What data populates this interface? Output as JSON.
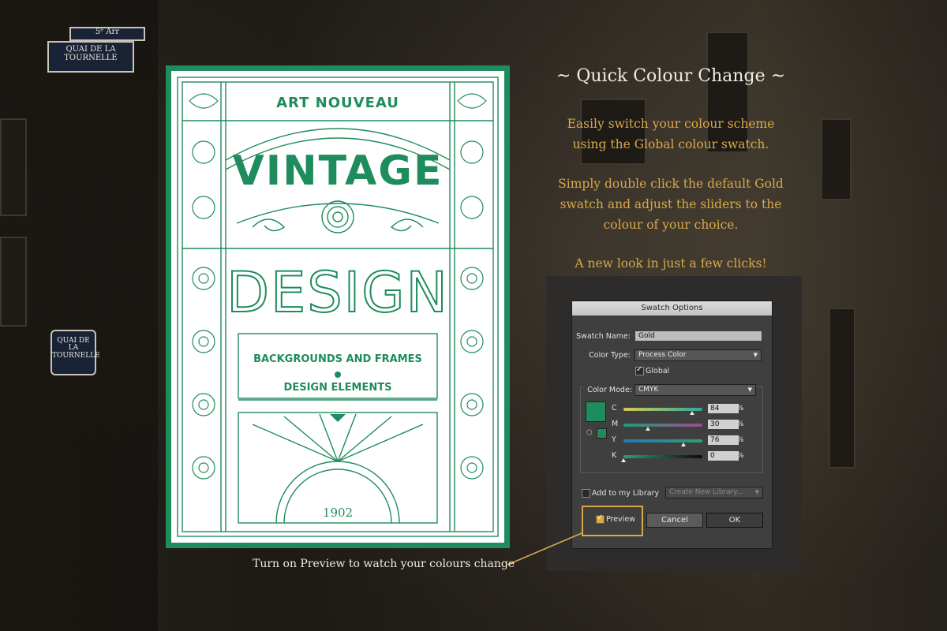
{
  "background": {
    "plaques": [
      "5ᵉ Arr",
      "QUAI DE LA TOURNELLE",
      "QUAI DE LA TOURNELLE"
    ]
  },
  "poster": {
    "top_line": "ART NOUVEAU",
    "word1": "VINTAGE",
    "word2": "DESIGN",
    "sub1": "BACKGROUNDS AND FRAMES",
    "sub2": "DESIGN ELEMENTS",
    "year": "1902",
    "color": "#1e8c5c"
  },
  "copy": {
    "heading": "~ Quick Colour Change ~",
    "p1_line1": "Easily switch your colour scheme",
    "p1_line2": "using the Global colour swatch.",
    "p2_line1": "Simply double click the default Gold",
    "p2_line2": "swatch and adjust the sliders to the",
    "p2_line3": "colour of your choice.",
    "p3": "A new look in just a few clicks!",
    "callout": "Turn on Preview to watch your colours change",
    "accent_color": "#d9a84a"
  },
  "dialog": {
    "title": "Swatch Options",
    "swatch_name_label": "Swatch Name:",
    "swatch_name_value": "Gold",
    "color_type_label": "Color Type:",
    "color_type_value": "Process Color",
    "global_label": "Global",
    "global_checked": true,
    "color_mode_label": "Color Mode:",
    "color_mode_value": "CMYK",
    "swatch_color": "#1e8c5c",
    "channels": [
      {
        "label": "C",
        "value": "84",
        "unit": "%"
      },
      {
        "label": "M",
        "value": "30",
        "unit": "%"
      },
      {
        "label": "Y",
        "value": "76",
        "unit": "%"
      },
      {
        "label": "K",
        "value": "0",
        "unit": "%"
      }
    ],
    "add_to_library_label": "Add to my Library",
    "library_placeholder": "Create New Library...",
    "preview_label": "Preview",
    "preview_checked": true,
    "cancel_label": "Cancel",
    "ok_label": "OK"
  }
}
